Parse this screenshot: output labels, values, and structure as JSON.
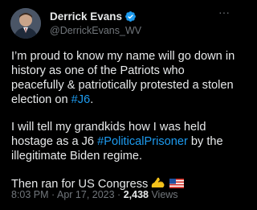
{
  "author": {
    "display_name": "Derrick Evans",
    "handle": "@DerrickEvans_WV",
    "verified_color": "#1d9bf0"
  },
  "menu": {
    "more_label": "···"
  },
  "tweet": {
    "p1_text": "I’m proud to know my name will go down in history as one of the Patriots who peacefully & patriotically protested a stolen election on ",
    "p1_tag": "#J6",
    "p1_end": ".",
    "p2_text": "I will tell my grandkids how I was held hostage as a J6 ",
    "p2_tag": "#PoliticalPrisoner",
    "p2_end": " by the illegitimate Biden regime.",
    "p3_text": "Then ran for US Congress",
    "emojis": [
      "flexed-biceps",
      "us-flag"
    ]
  },
  "meta": {
    "time": "8:03 PM",
    "separator": " · ",
    "date": "Apr 17, 2023",
    "separator2": " · ",
    "views_count": "2,438",
    "views_label": " Views"
  },
  "colors": {
    "background": "#000000",
    "text": "#e7e9ea",
    "muted": "#71767b",
    "link": "#1d9bf0"
  }
}
